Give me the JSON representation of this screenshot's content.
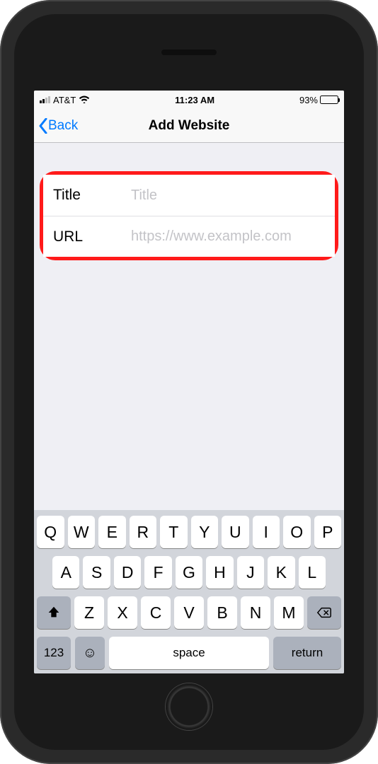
{
  "status": {
    "carrier": "AT&T",
    "time": "11:23 AM",
    "battery_pct": "93%"
  },
  "nav": {
    "back_label": "Back",
    "title": "Add Website"
  },
  "form": {
    "title": {
      "label": "Title",
      "placeholder": "Title",
      "value": ""
    },
    "url": {
      "label": "URL",
      "placeholder": "https://www.example.com",
      "value": ""
    }
  },
  "keyboard": {
    "row1": [
      "Q",
      "W",
      "E",
      "R",
      "T",
      "Y",
      "U",
      "I",
      "O",
      "P"
    ],
    "row2": [
      "A",
      "S",
      "D",
      "F",
      "G",
      "H",
      "J",
      "K",
      "L"
    ],
    "row3": [
      "Z",
      "X",
      "C",
      "V",
      "B",
      "N",
      "M"
    ],
    "numeric_label": "123",
    "space_label": "space",
    "return_label": "return"
  }
}
